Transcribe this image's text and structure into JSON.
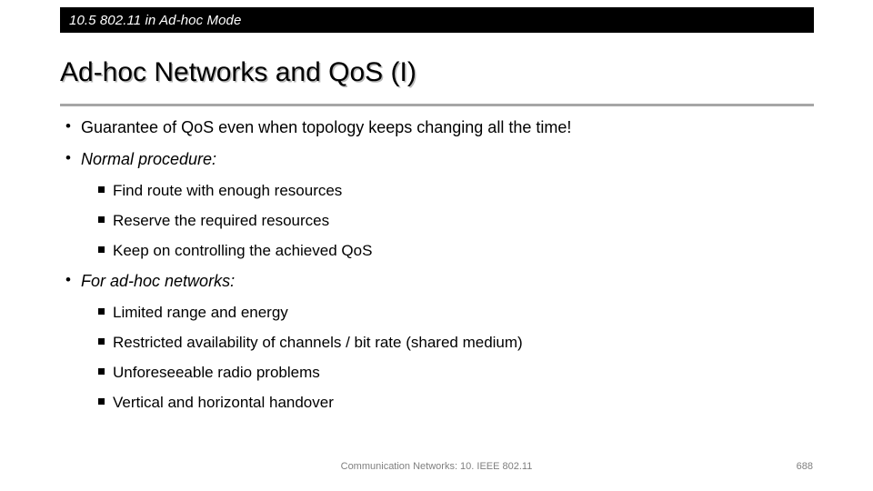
{
  "section_header": {
    "label": "10.5 802.11 in Ad-hoc Mode",
    "background_color": "#000000",
    "text_color": "#ffffff"
  },
  "title": {
    "text": "Ad-hoc Networks and QoS (I)",
    "rule_color": "#a6a6a6"
  },
  "content": {
    "bullets": [
      {
        "level": 1,
        "text": "Guarantee of QoS even when topology keeps changing all the time!",
        "italic": false
      },
      {
        "level": 1,
        "text": "Normal procedure:",
        "italic": true
      },
      {
        "level": 2,
        "text": "Find route with enough resources"
      },
      {
        "level": 2,
        "text": "Reserve the required resources"
      },
      {
        "level": 2,
        "text": "Keep on controlling the achieved QoS"
      },
      {
        "level": 1,
        "text": "For ad-hoc networks:",
        "italic": true
      },
      {
        "level": 2,
        "text": "Limited range and energy"
      },
      {
        "level": 2,
        "text": "Restricted availability of channels / bit rate (shared medium)"
      },
      {
        "level": 2,
        "text": "Unforeseeable radio problems"
      },
      {
        "level": 2,
        "text": "Vertical and horizontal handover"
      }
    ]
  },
  "footer": {
    "note": "Communication Networks: 10. IEEE 802.11",
    "page_number": "688",
    "text_color": "#808080"
  }
}
